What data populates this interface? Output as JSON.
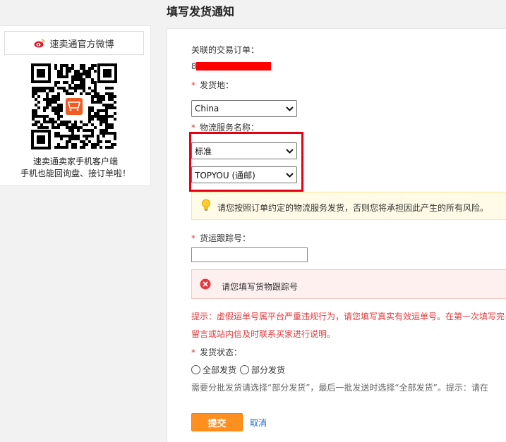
{
  "page": {
    "title": "填写发货通知"
  },
  "promo": {
    "weibo_label": "速卖通官方微博",
    "text_line1": "速卖通卖家手机客户端",
    "text_line2": "手机也能回询盘、接订单啦！"
  },
  "form": {
    "order_label": "关联的交易订单：",
    "order_prefix": "8",
    "ship_from_label": "发货地：",
    "ship_from_value": "China",
    "logistics_label": "物流服务名称：",
    "logistics_type_value": "标准",
    "logistics_provider_value": "TOPYOU (通邮)",
    "warning_tip": "请您按照订单约定的物流服务发货，否则您将承担因此产生的所有风险。",
    "tracking_label": "货运跟踪号：",
    "tracking_error": "请您填写货物跟踪号",
    "hint_line1": "提示：虚假运单号属平台严重违规行为，请您填写真实有效运单号。在第一次填写完",
    "hint_line2": "留言或站内信及时联系买家进行说明。",
    "status_label": "发货状态：",
    "status_full": "全部发货",
    "status_partial": "部分发货",
    "status_hint": "需要分批发货请选择“部分发货”，最后一批发送时选择“全部发货”。提示：请在",
    "submit_label": "提交",
    "cancel_label": "取消"
  },
  "colors": {
    "accent": "#ff8f1f",
    "required": "#e4393c",
    "link": "#1a66c8",
    "highlight_box": "#e60012"
  }
}
